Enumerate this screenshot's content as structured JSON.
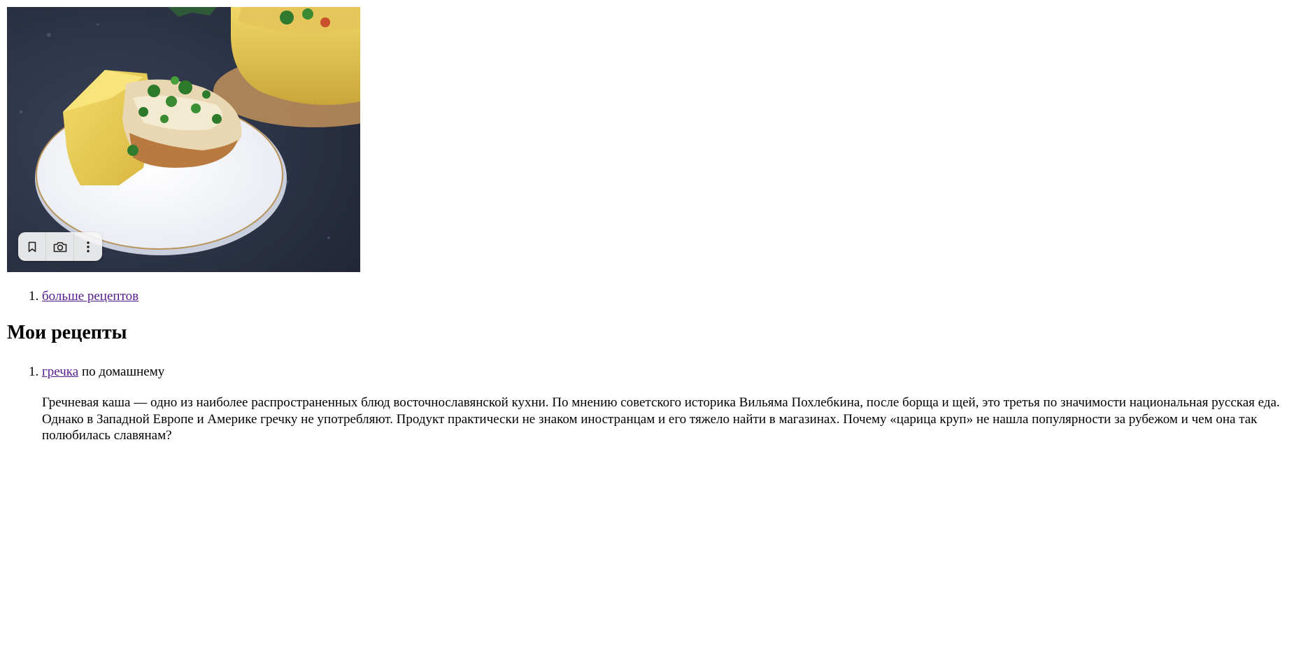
{
  "photo": {
    "alt_subject": "slice of cornbread pie with filling on a white plate",
    "toolbar": {
      "buttons": [
        {
          "icon": "bookmark-icon"
        },
        {
          "icon": "camera-icon"
        },
        {
          "icon": "more-vertical-icon"
        }
      ],
      "background": "#f5f5f5"
    }
  },
  "more_recipes": {
    "link_label": "больше рецептов"
  },
  "heading": "Мои рецепты",
  "recipes": [
    {
      "link_label": "гречка",
      "title_rest": " по домашнему",
      "description": "Гречневая каша — одно из наиболее распространенных блюд восточнославянской кухни. По мнению советского историка Вильяма Похлебкина, после борща и щей, это третья по значимости национальная русская еда. Однако в Западной Европе и Америке гречку не употребляют. Продукт практически не знаком иностранцам и его тяжело найти в магазинах. Почему «царица круп» не нашла популярности за рубежом и чем она так полюбилась славянам?"
    }
  ],
  "colors": {
    "link": "#551a8b",
    "text": "#000000",
    "background": "#ffffff"
  }
}
